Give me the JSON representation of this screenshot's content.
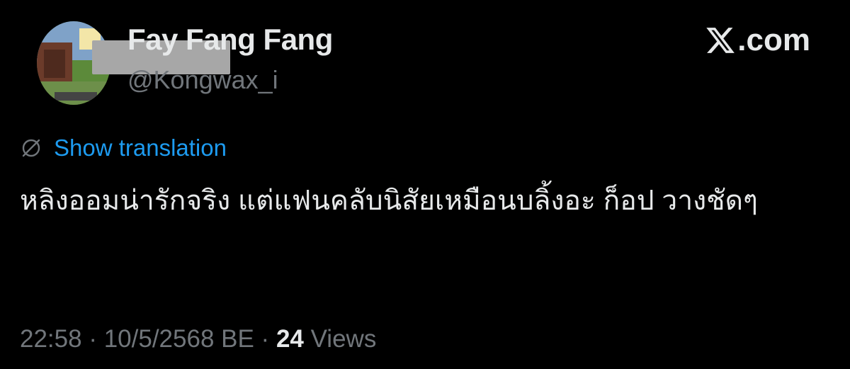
{
  "author": {
    "display_name": "Fay Fang Fang",
    "handle": "@Kongwax_i"
  },
  "site_label": ".com",
  "translate_label": "Show translation",
  "tweet_text": "หลิงออมน่ารักจริง แต่แฟนคลับนิสัยเหมือนบลิ้งอะ ก็อป วางชัดๆ",
  "meta": {
    "time": "22:58",
    "sep1": " · ",
    "date": "10/5/2568 BE",
    "sep2": " · ",
    "views_count": "24",
    "views_label": " Views"
  },
  "colors": {
    "background": "#000000",
    "text": "#e7e9ea",
    "secondary": "#71767b",
    "link": "#1d9bf0"
  }
}
